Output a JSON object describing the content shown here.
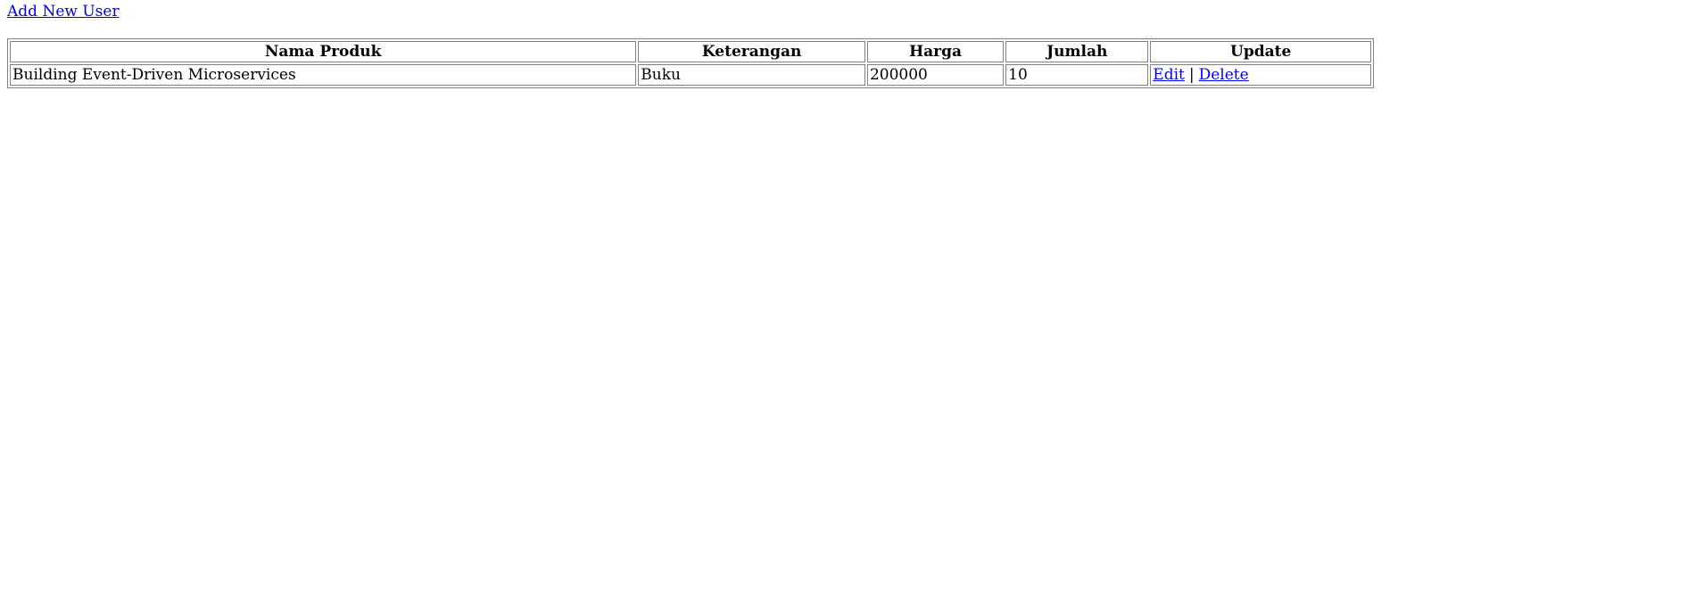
{
  "links": {
    "add_new_user": "Add New User"
  },
  "table": {
    "headers": [
      "Nama Produk",
      "Keterangan",
      "Harga",
      "Jumlah",
      "Update"
    ],
    "rows": [
      {
        "nama_produk": "Building Event-Driven Microservices",
        "keterangan": "Buku",
        "harga": "200000",
        "jumlah": "10",
        "edit_label": "Edit",
        "separator": "|",
        "delete_label": "Delete"
      }
    ]
  },
  "colors": {
    "link": "#0000ee",
    "border": "#808080",
    "text": "#000000",
    "background": "#ffffff"
  }
}
